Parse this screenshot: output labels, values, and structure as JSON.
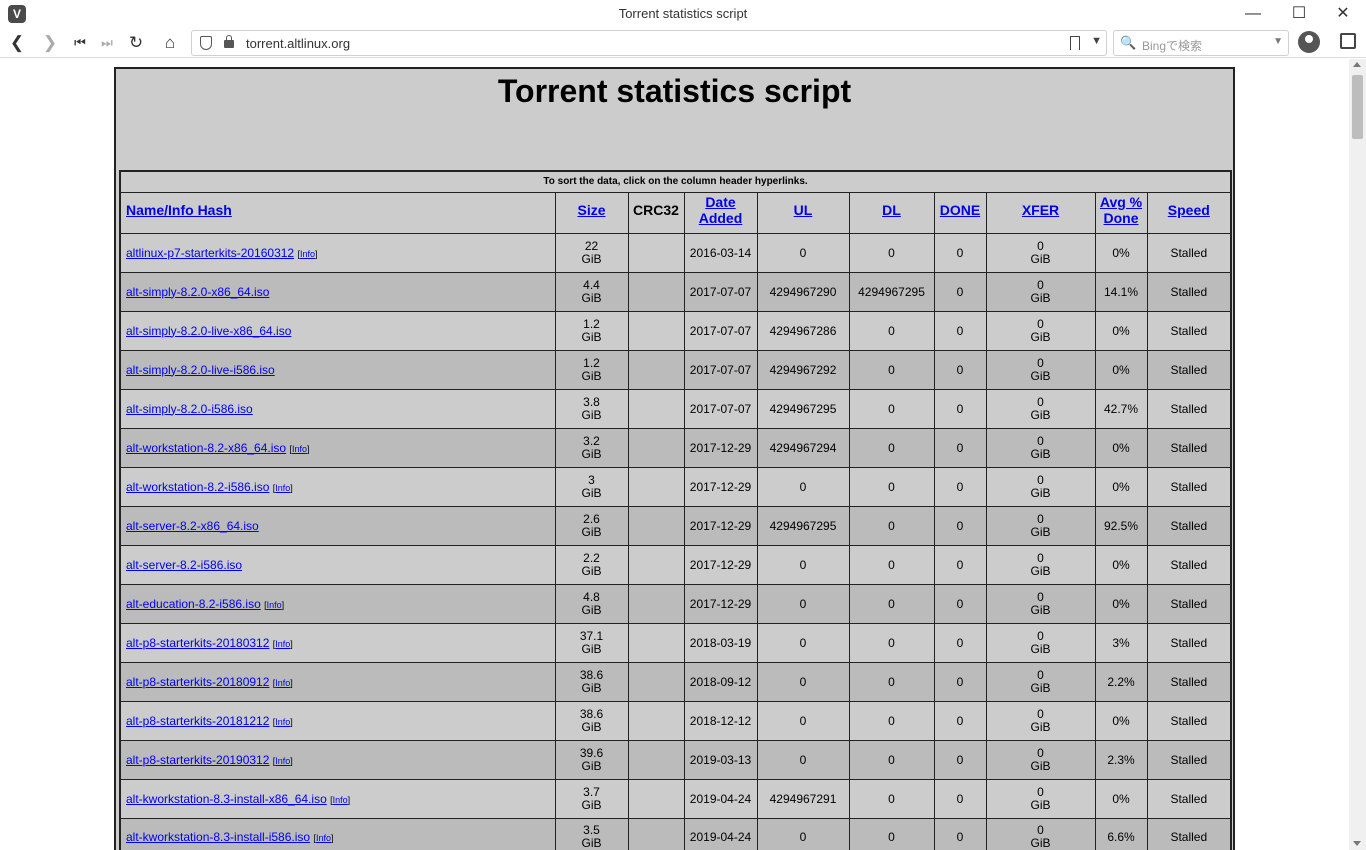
{
  "browser": {
    "window_title": "Torrent statistics script",
    "url": "torrent.altlinux.org",
    "search_placeholder": "Bingで検索"
  },
  "page": {
    "title": "Torrent statistics script",
    "sort_note": "To sort the data, click on the column header hyperlinks.",
    "columns": {
      "name": "Name/Info Hash",
      "size": "Size",
      "crc32": "CRC32",
      "date_line1": "Date",
      "date_line2": "Added",
      "ul": "UL",
      "dl": "DL",
      "done": "DONE",
      "xfer": "XFER",
      "avg_line1": "Avg %",
      "avg_line2": "Done",
      "speed": "Speed"
    },
    "info_label": "Info",
    "rows": [
      {
        "name": "altlinux-p7-starterkits-20160312",
        "info": true,
        "size": "22",
        "size_unit": "GiB",
        "crc": "",
        "date": "2016-03-14",
        "ul": "0",
        "dl": "0",
        "done": "0",
        "xfer": "0",
        "xfer_unit": "GiB",
        "avg": "0%",
        "speed": "Stalled"
      },
      {
        "name": "alt-simply-8.2.0-x86_64.iso",
        "info": false,
        "size": "4.4",
        "size_unit": "GiB",
        "crc": "",
        "date": "2017-07-07",
        "ul": "4294967290",
        "dl": "4294967295",
        "done": "0",
        "xfer": "0",
        "xfer_unit": "GiB",
        "avg": "14.1%",
        "speed": "Stalled"
      },
      {
        "name": "alt-simply-8.2.0-live-x86_64.iso",
        "info": false,
        "size": "1.2",
        "size_unit": "GiB",
        "crc": "",
        "date": "2017-07-07",
        "ul": "4294967286",
        "dl": "0",
        "done": "0",
        "xfer": "0",
        "xfer_unit": "GiB",
        "avg": "0%",
        "speed": "Stalled"
      },
      {
        "name": "alt-simply-8.2.0-live-i586.iso",
        "info": false,
        "size": "1.2",
        "size_unit": "GiB",
        "crc": "",
        "date": "2017-07-07",
        "ul": "4294967292",
        "dl": "0",
        "done": "0",
        "xfer": "0",
        "xfer_unit": "GiB",
        "avg": "0%",
        "speed": "Stalled"
      },
      {
        "name": "alt-simply-8.2.0-i586.iso",
        "info": false,
        "size": "3.8",
        "size_unit": "GiB",
        "crc": "",
        "date": "2017-07-07",
        "ul": "4294967295",
        "dl": "0",
        "done": "0",
        "xfer": "0",
        "xfer_unit": "GiB",
        "avg": "42.7%",
        "speed": "Stalled"
      },
      {
        "name": "alt-workstation-8.2-x86_64.iso",
        "info": true,
        "size": "3.2",
        "size_unit": "GiB",
        "crc": "",
        "date": "2017-12-29",
        "ul": "4294967294",
        "dl": "0",
        "done": "0",
        "xfer": "0",
        "xfer_unit": "GiB",
        "avg": "0%",
        "speed": "Stalled"
      },
      {
        "name": "alt-workstation-8.2-i586.iso",
        "info": true,
        "size": "3",
        "size_unit": "GiB",
        "crc": "",
        "date": "2017-12-29",
        "ul": "0",
        "dl": "0",
        "done": "0",
        "xfer": "0",
        "xfer_unit": "GiB",
        "avg": "0%",
        "speed": "Stalled"
      },
      {
        "name": "alt-server-8.2-x86_64.iso",
        "info": false,
        "size": "2.6",
        "size_unit": "GiB",
        "crc": "",
        "date": "2017-12-29",
        "ul": "4294967295",
        "dl": "0",
        "done": "0",
        "xfer": "0",
        "xfer_unit": "GiB",
        "avg": "92.5%",
        "speed": "Stalled"
      },
      {
        "name": "alt-server-8.2-i586.iso",
        "info": false,
        "size": "2.2",
        "size_unit": "GiB",
        "crc": "",
        "date": "2017-12-29",
        "ul": "0",
        "dl": "0",
        "done": "0",
        "xfer": "0",
        "xfer_unit": "GiB",
        "avg": "0%",
        "speed": "Stalled"
      },
      {
        "name": "alt-education-8.2-i586.iso",
        "info": true,
        "size": "4.8",
        "size_unit": "GiB",
        "crc": "",
        "date": "2017-12-29",
        "ul": "0",
        "dl": "0",
        "done": "0",
        "xfer": "0",
        "xfer_unit": "GiB",
        "avg": "0%",
        "speed": "Stalled"
      },
      {
        "name": "alt-p8-starterkits-20180312",
        "info": true,
        "size": "37.1",
        "size_unit": "GiB",
        "crc": "",
        "date": "2018-03-19",
        "ul": "0",
        "dl": "0",
        "done": "0",
        "xfer": "0",
        "xfer_unit": "GiB",
        "avg": "3%",
        "speed": "Stalled"
      },
      {
        "name": "alt-p8-starterkits-20180912",
        "info": true,
        "size": "38.6",
        "size_unit": "GiB",
        "crc": "",
        "date": "2018-09-12",
        "ul": "0",
        "dl": "0",
        "done": "0",
        "xfer": "0",
        "xfer_unit": "GiB",
        "avg": "2.2%",
        "speed": "Stalled"
      },
      {
        "name": "alt-p8-starterkits-20181212",
        "info": true,
        "size": "38.6",
        "size_unit": "GiB",
        "crc": "",
        "date": "2018-12-12",
        "ul": "0",
        "dl": "0",
        "done": "0",
        "xfer": "0",
        "xfer_unit": "GiB",
        "avg": "0%",
        "speed": "Stalled"
      },
      {
        "name": "alt-p8-starterkits-20190312",
        "info": true,
        "size": "39.6",
        "size_unit": "GiB",
        "crc": "",
        "date": "2019-03-13",
        "ul": "0",
        "dl": "0",
        "done": "0",
        "xfer": "0",
        "xfer_unit": "GiB",
        "avg": "2.3%",
        "speed": "Stalled"
      },
      {
        "name": "alt-kworkstation-8.3-install-x86_64.iso",
        "info": true,
        "size": "3.7",
        "size_unit": "GiB",
        "crc": "",
        "date": "2019-04-24",
        "ul": "4294967291",
        "dl": "0",
        "done": "0",
        "xfer": "0",
        "xfer_unit": "GiB",
        "avg": "0%",
        "speed": "Stalled"
      },
      {
        "name": "alt-kworkstation-8.3-install-i586.iso",
        "info": true,
        "size": "3.5",
        "size_unit": "GiB",
        "crc": "",
        "date": "2019-04-24",
        "ul": "0",
        "dl": "0",
        "done": "0",
        "xfer": "0",
        "xfer_unit": "GiB",
        "avg": "6.6%",
        "speed": "Stalled"
      }
    ]
  }
}
